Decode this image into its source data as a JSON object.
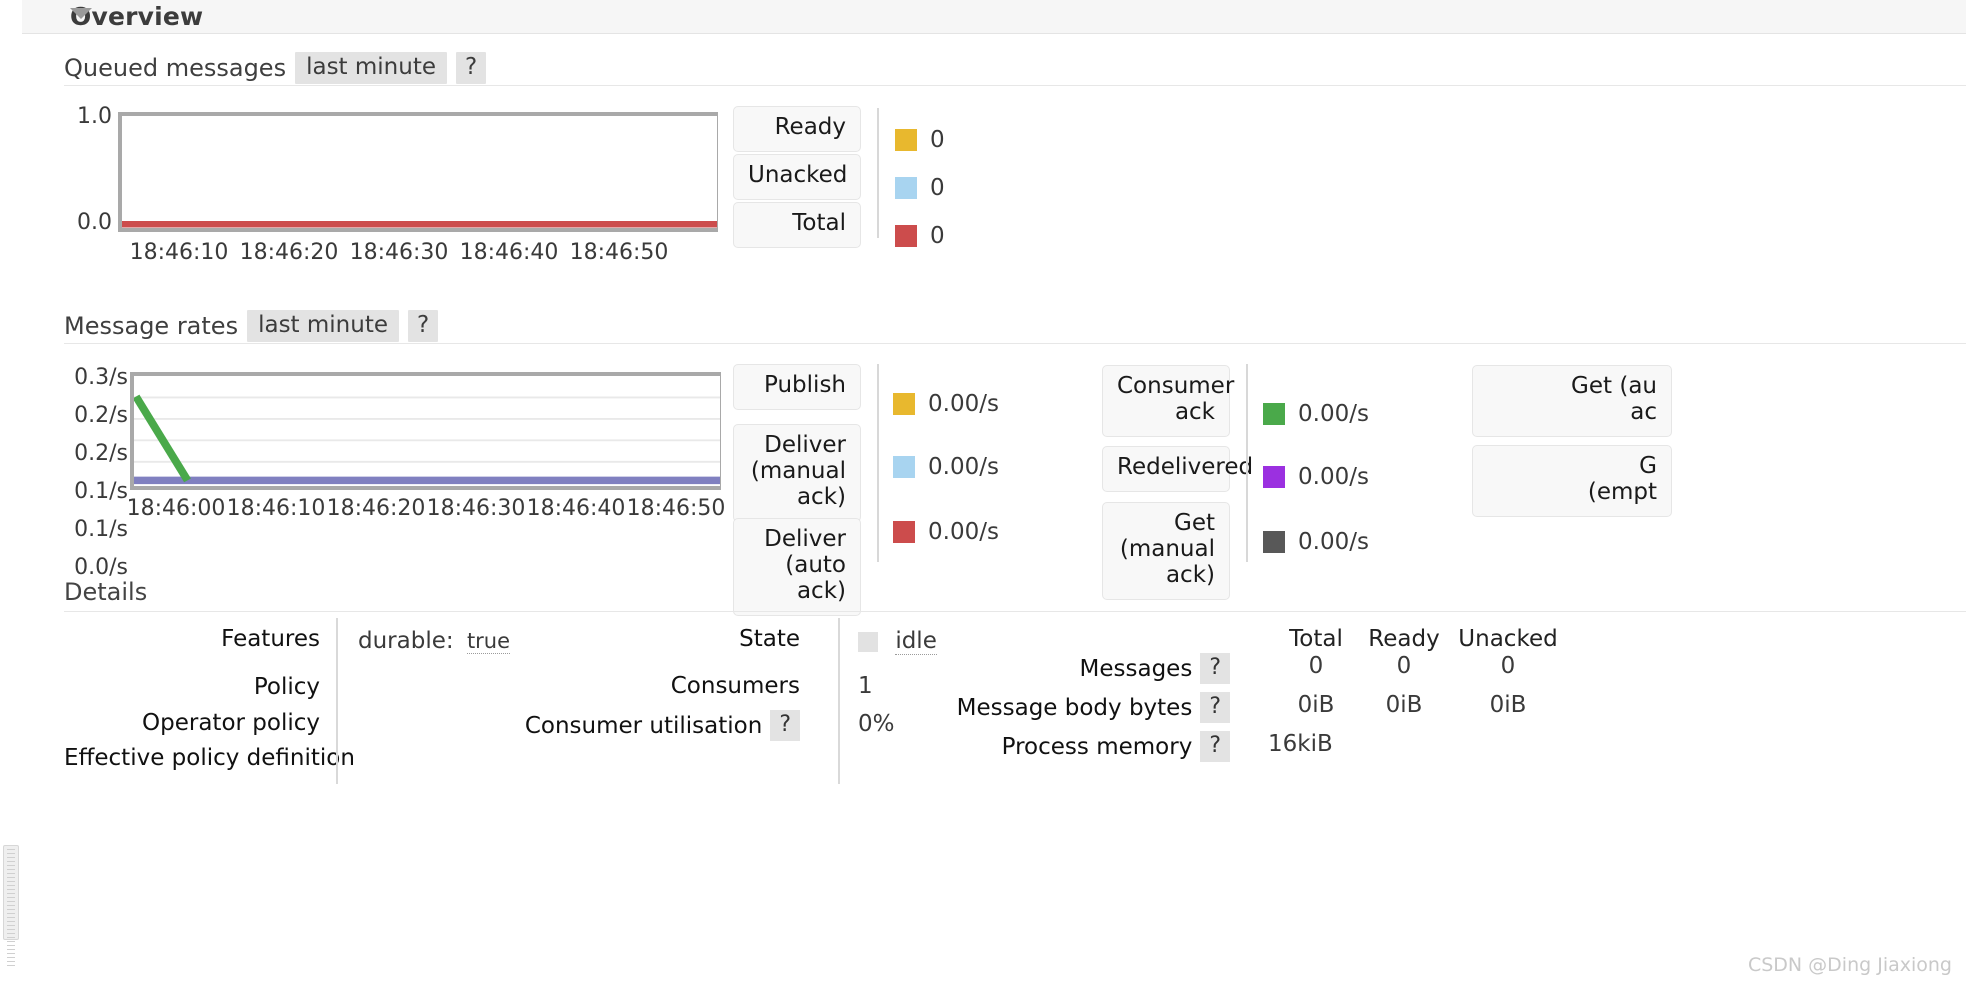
{
  "section": {
    "title": "Overview",
    "collapse_icon": "triangle-down-icon"
  },
  "queued_messages": {
    "label": "Queued messages",
    "period": "last minute",
    "help": "?",
    "legend": [
      {
        "name": "Ready",
        "value": "0",
        "color": "#e8b82e"
      },
      {
        "name": "Unacked",
        "value": "0",
        "color": "#a8d4f0"
      },
      {
        "name": "Total",
        "value": "0",
        "color": "#cc4c4c"
      }
    ]
  },
  "message_rates": {
    "label": "Message rates",
    "period": "last minute",
    "help": "?",
    "legend_col1": [
      {
        "name": "Publish",
        "value": "0.00/s",
        "color": "#e8b82e"
      },
      {
        "name": "Deliver\n(manual\nack)",
        "value": "0.00/s",
        "color": "#a8d4f0"
      },
      {
        "name": "Deliver\n(auto ack)",
        "value": "0.00/s",
        "color": "#cc4c4c"
      }
    ],
    "legend_col2": [
      {
        "name": "Consumer\nack",
        "value": "0.00/s",
        "color": "#4aa94a"
      },
      {
        "name": "Redelivered",
        "value": "0.00/s",
        "color": "#9b30e0"
      },
      {
        "name": "Get\n(manual\nack)",
        "value": "0.00/s",
        "color": "#585858"
      }
    ],
    "legend_col3": [
      {
        "name": "Get (au\nac"
      },
      {
        "name": "G\n(empt"
      }
    ]
  },
  "chart_data": [
    {
      "type": "line",
      "title": "Queued messages",
      "subtitle": "last minute",
      "xlabel": "",
      "ylabel": "",
      "yticks": [
        "1.0",
        "0.0"
      ],
      "ylim": [
        0,
        1
      ],
      "x": [
        "18:46:10",
        "18:46:20",
        "18:46:30",
        "18:46:40",
        "18:46:50"
      ],
      "grid": false,
      "legend_position": "right",
      "series": [
        {
          "name": "Ready",
          "color": "#e8b82e",
          "values": [
            0,
            0,
            0,
            0,
            0
          ]
        },
        {
          "name": "Unacked",
          "color": "#a8d4f0",
          "values": [
            0,
            0,
            0,
            0,
            0
          ]
        },
        {
          "name": "Total",
          "color": "#cc4c4c",
          "values": [
            0,
            0,
            0,
            0,
            0
          ]
        }
      ]
    },
    {
      "type": "line",
      "title": "Message rates",
      "subtitle": "last minute",
      "xlabel": "",
      "ylabel": "",
      "yticks": [
        "0.3/s",
        "0.2/s",
        "0.2/s",
        "0.1/s",
        "0.1/s",
        "0.0/s"
      ],
      "ylim": [
        0,
        0.3
      ],
      "x": [
        "18:46:00",
        "18:46:10",
        "18:46:20",
        "18:46:30",
        "18:46:40",
        "18:46:50"
      ],
      "grid": true,
      "legend_position": "right",
      "series": [
        {
          "name": "Consumer ack",
          "color": "#4aa94a",
          "values": [
            0.22,
            0.0,
            0.0,
            0.0,
            0.0,
            0.0
          ]
        },
        {
          "name": "Redelivered",
          "color": "#8080c0",
          "values": [
            0,
            0,
            0,
            0,
            0,
            0
          ]
        }
      ]
    }
  ],
  "details": {
    "title": "Details",
    "left": {
      "rows": [
        {
          "label": "Features",
          "value_prefix": "durable:",
          "value": "true"
        },
        {
          "label": "Policy",
          "value_prefix": "",
          "value": ""
        },
        {
          "label": "Operator policy",
          "value_prefix": "",
          "value": ""
        },
        {
          "label": "Effective policy definition",
          "value_prefix": "",
          "value": ""
        }
      ]
    },
    "middle": {
      "rows": [
        {
          "label": "State",
          "help": "",
          "value": "idle"
        },
        {
          "label": "Consumers",
          "help": "",
          "value": "1"
        },
        {
          "label": "Consumer utilisation",
          "help": "?",
          "value": "0%"
        }
      ]
    },
    "right": {
      "columns": [
        "Total",
        "Ready",
        "Unacked"
      ],
      "rows": [
        {
          "label": "Messages",
          "help": "?",
          "values": [
            "0",
            "0",
            "0"
          ]
        },
        {
          "label": "Message body bytes",
          "help": "?",
          "values": [
            "0iB",
            "0iB",
            "0iB"
          ]
        },
        {
          "label": "Process memory",
          "help": "?",
          "values": [
            "16kiB",
            "",
            ""
          ]
        }
      ]
    }
  },
  "watermark": "CSDN @Ding Jiaxiong"
}
